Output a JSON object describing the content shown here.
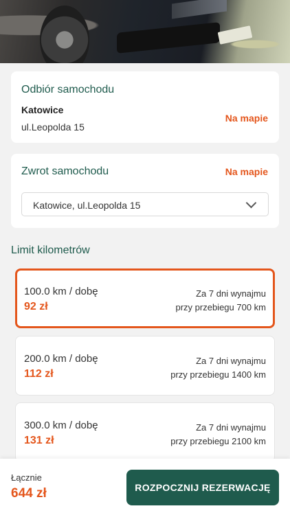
{
  "pickup": {
    "title": "Odbiór samochodu",
    "map_link": "Na mapie",
    "city": "Katowice",
    "street": "ul.Leopolda 15"
  },
  "return": {
    "title": "Zwrot samochodu",
    "map_link": "Na mapie",
    "selected_location": "Katowice, ul.Leopolda 15"
  },
  "mileage": {
    "title": "Limit kilometrów",
    "options": [
      {
        "per_day": "100.0 km / dobę",
        "price": "92 zł",
        "rental_info": "Za 7 dni wynajmu",
        "mileage_info": "przy przebiegu 700 km",
        "selected": true
      },
      {
        "per_day": "200.0 km / dobę",
        "price": "112 zł",
        "rental_info": "Za 7 dni wynajmu",
        "mileage_info": "przy przebiegu 1400 km",
        "selected": false
      },
      {
        "per_day": "300.0 km / dobę",
        "price": "131 zł",
        "rental_info": "Za 7 dni wynajmu",
        "mileage_info": "przy przebiegu 2100 km",
        "selected": false
      }
    ]
  },
  "footer": {
    "total_label": "Łącznie",
    "total_value": "644 zł",
    "cta_label": "ROZPOCZNIJ REZERWACJĘ"
  },
  "colors": {
    "accent": "#e4561c",
    "brand": "#1f5b4d"
  },
  "icons": {
    "dropdown": "chevron-down-icon"
  }
}
